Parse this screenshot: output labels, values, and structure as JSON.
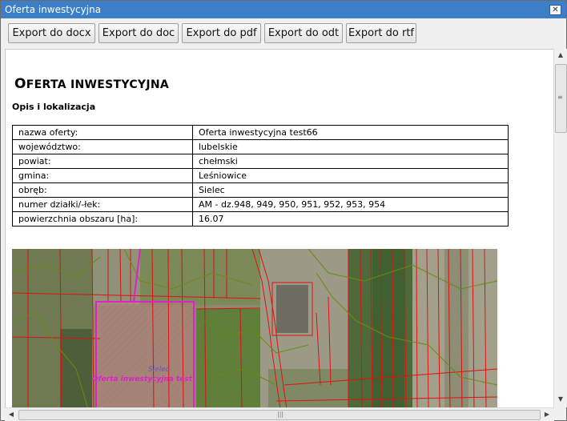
{
  "window": {
    "title": "Oferta inwestycyjna",
    "close_glyph": "✕"
  },
  "toolbar": {
    "buttons": [
      "Export do docx",
      "Export do doc",
      "Export do pdf",
      "Export do odt",
      "Export do rtf"
    ]
  },
  "document": {
    "title_first": "O",
    "title_rest": "FERTA INWESTYCYJNA",
    "section": "Opis i lokalizacja",
    "rows": [
      {
        "label": "nazwa oferty:",
        "value": "Oferta inwestycyjna test66"
      },
      {
        "label": "województwo:",
        "value": "lubelskie"
      },
      {
        "label": "powiat:",
        "value": "chełmski"
      },
      {
        "label": "gmina:",
        "value": "Leśniowice"
      },
      {
        "label": "obręb:",
        "value": "Sielec"
      },
      {
        "label": "numer działki/-łek:",
        "value": "AM - dz.948, 949, 950, 951, 952, 953, 954"
      },
      {
        "label": "powierzchnia obszaru [ha]:",
        "value": "16.07"
      }
    ]
  },
  "map": {
    "place_label": "Sielec",
    "offer_label": "Oferta inwestycyjna test",
    "colors": {
      "parcel": "#e01010",
      "highlight": "#e020c8",
      "contour": "#6a8a10"
    }
  },
  "scrollbars": {
    "vertical": "vertical-scrollbar",
    "horizontal": "horizontal-scrollbar"
  }
}
